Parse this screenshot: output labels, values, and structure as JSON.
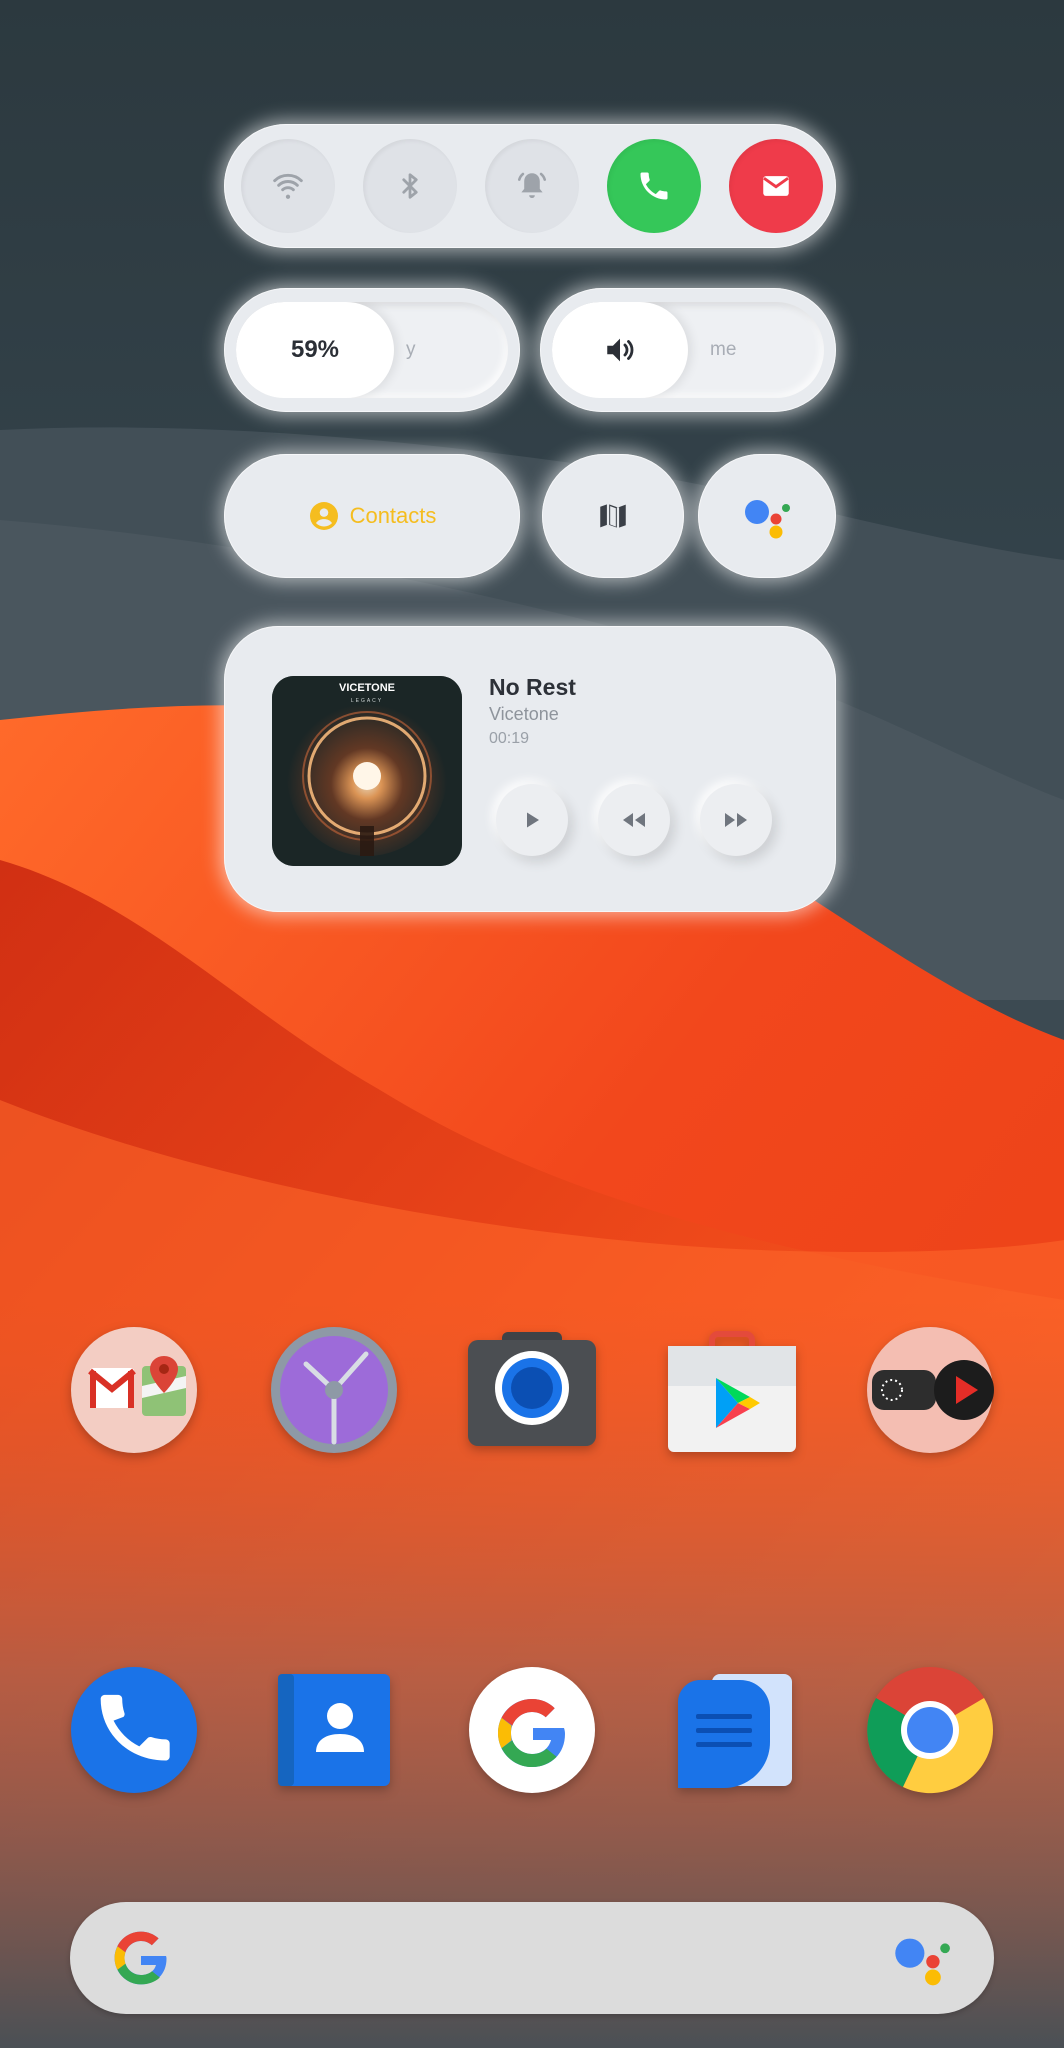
{
  "quick_toggles": [
    {
      "name": "wifi",
      "icon": "wifi-icon",
      "state": "off"
    },
    {
      "name": "bluetooth",
      "icon": "bluetooth-icon",
      "state": "off"
    },
    {
      "name": "notifications",
      "icon": "bell-icon",
      "state": "off"
    },
    {
      "name": "phone",
      "icon": "phone-icon",
      "color": "#35c759"
    },
    {
      "name": "mail",
      "icon": "mail-icon",
      "color": "#ef3b4a"
    }
  ],
  "brightness": {
    "value_text": "59%",
    "label": "y",
    "level": 0.59
  },
  "volume": {
    "label": "me",
    "icon": "speaker-icon",
    "level": 0.5
  },
  "shortcuts": {
    "contacts_label": "Contacts",
    "contacts_color": "#f5bd1f",
    "map_icon": "map-icon",
    "assistant_icon": "google-assistant-icon"
  },
  "music": {
    "title": "No Rest",
    "artist": "Vicetone",
    "time": "00:19",
    "album_text": "VICETONE",
    "album_subtext": "LEGACY",
    "buttons": [
      "play-icon",
      "rewind-icon",
      "fast-forward-icon"
    ]
  },
  "apps_row1": [
    "gmail-maps-folder",
    "clock",
    "camera",
    "play-store",
    "youtube-folder"
  ],
  "apps_row2": [
    "phone",
    "contacts",
    "google",
    "messages",
    "chrome"
  ],
  "search": {
    "placeholder": ""
  }
}
